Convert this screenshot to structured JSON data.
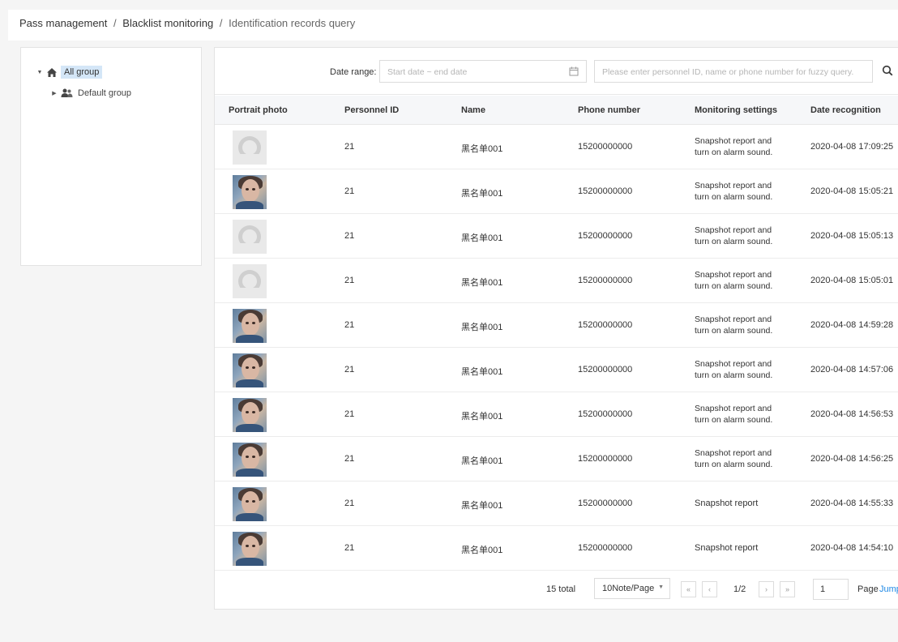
{
  "breadcrumb": {
    "items": [
      "Pass management",
      "Blacklist monitoring",
      "Identification records query"
    ],
    "separator": "/"
  },
  "tree": {
    "root_label": "All group",
    "child_label": "Default group",
    "root_icon": "home-icon",
    "child_icon": "users-icon"
  },
  "filters": {
    "date_label": "Date range:",
    "date_placeholder": "Start date ~ end date",
    "search_placeholder": "Please enter personnel ID, name or phone number for fuzzy query."
  },
  "table": {
    "headers": [
      "Portrait photo",
      "Personnel ID",
      "Name",
      "Phone number",
      "Monitoring settings",
      "Date recognition"
    ],
    "rows": [
      {
        "photo": "default",
        "id": "21",
        "name": "黑名单001",
        "phone": "15200000000",
        "setting_1": "Snapshot report and",
        "setting_2": "turn on alarm sound.",
        "date": "2020-04-08 17:09:25"
      },
      {
        "photo": "face",
        "id": "21",
        "name": "黑名单001",
        "phone": "15200000000",
        "setting_1": "Snapshot report and",
        "setting_2": "turn on alarm sound.",
        "date": "2020-04-08 15:05:21"
      },
      {
        "photo": "default",
        "id": "21",
        "name": "黑名单001",
        "phone": "15200000000",
        "setting_1": "Snapshot report and",
        "setting_2": "turn on alarm sound.",
        "date": "2020-04-08 15:05:13"
      },
      {
        "photo": "default",
        "id": "21",
        "name": "黑名单001",
        "phone": "15200000000",
        "setting_1": "Snapshot report and",
        "setting_2": "turn on alarm sound.",
        "date": "2020-04-08 15:05:01"
      },
      {
        "photo": "face",
        "id": "21",
        "name": "黑名单001",
        "phone": "15200000000",
        "setting_1": "Snapshot report and",
        "setting_2": "turn on alarm sound.",
        "date": "2020-04-08 14:59:28"
      },
      {
        "photo": "face",
        "id": "21",
        "name": "黑名单001",
        "phone": "15200000000",
        "setting_1": "Snapshot report and",
        "setting_2": "turn on alarm sound.",
        "date": "2020-04-08 14:57:06"
      },
      {
        "photo": "face",
        "id": "21",
        "name": "黑名单001",
        "phone": "15200000000",
        "setting_1": "Snapshot report and",
        "setting_2": "turn on alarm sound.",
        "date": "2020-04-08 14:56:53"
      },
      {
        "photo": "face",
        "id": "21",
        "name": "黑名单001",
        "phone": "15200000000",
        "setting_1": "Snapshot report and",
        "setting_2": "turn on alarm sound.",
        "date": "2020-04-08 14:56:25"
      },
      {
        "photo": "face",
        "id": "21",
        "name": "黑名单001",
        "phone": "15200000000",
        "setting_1": "Snapshot report",
        "setting_2": "",
        "date": "2020-04-08 14:55:33"
      },
      {
        "photo": "face",
        "id": "21",
        "name": "黑名单001",
        "phone": "15200000000",
        "setting_1": "Snapshot report",
        "setting_2": "",
        "date": "2020-04-08 14:54:10"
      }
    ]
  },
  "pagination": {
    "total": "15 total",
    "page_size": "10Note/Page",
    "first": "«",
    "prev": "‹",
    "indicator": "1/2",
    "next": "›",
    "last": "»",
    "goto_value": "1",
    "page_label": "Page",
    "jump_label": "Jump"
  },
  "colors": {
    "accent": "#1e88e5",
    "selected_bg": "#d4e6f7"
  }
}
